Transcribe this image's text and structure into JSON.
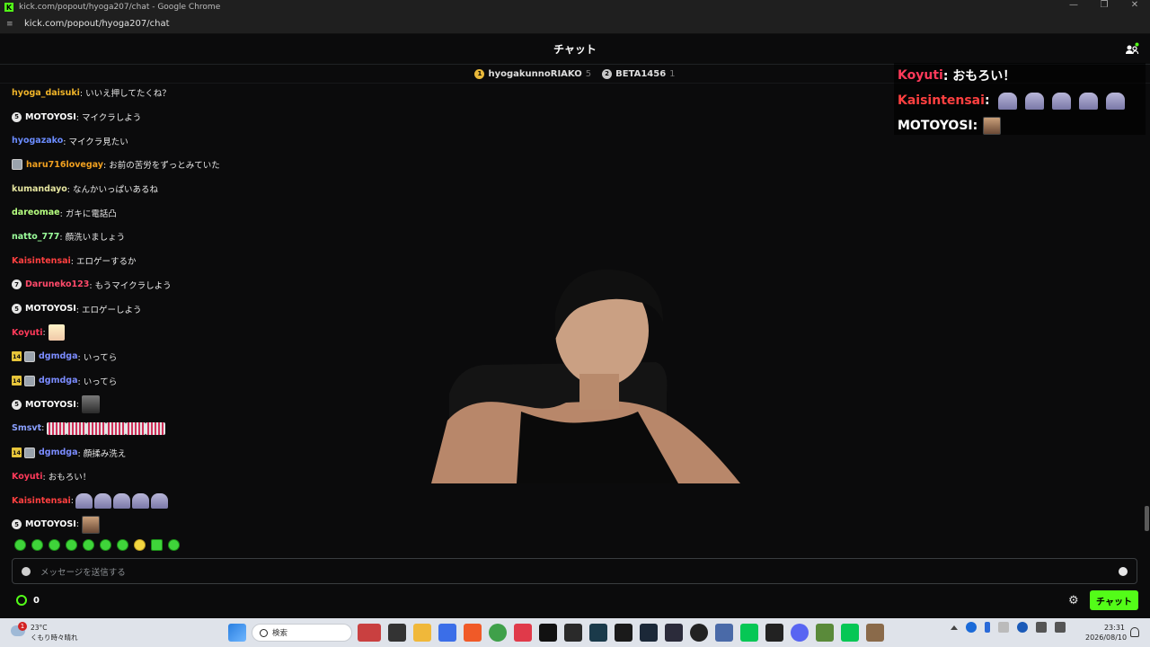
{
  "window": {
    "title": "kick.com/popout/hyoga207/chat - Google Chrome",
    "url": "kick.com/popout/hyoga207/chat"
  },
  "header": {
    "title": "チャット"
  },
  "gifters": [
    {
      "name": "hyogakunnoRIAKO",
      "count": "5",
      "color": "#e8b83a"
    },
    {
      "name": "BETA1456",
      "count": "1",
      "color": "#c8c8c8"
    }
  ],
  "colors": {
    "accent": "#53fc18"
  },
  "messages": [
    {
      "user": "hyoga_daisuki",
      "color": "#f0b429",
      "text": ": いいえ押してたくね？"
    },
    {
      "user": "MOTOYOSI",
      "color": "#ffffff",
      "badge": "5",
      "text": ": マイクラしよう"
    },
    {
      "user": "hyogazako",
      "color": "#6b8cff",
      "text": ": マイクラ見たい"
    },
    {
      "user": "haru716lovegay",
      "color": "#f0a020",
      "text": ": お前の苦労をずっとみていた"
    },
    {
      "user": "kumandayo",
      "color": "#e6e6a0",
      "text": ": なんかいっぱいあるね"
    },
    {
      "user": "dareomae",
      "color": "#b6ff80",
      "text": ": ガキに電話凸"
    },
    {
      "user": "natto_777",
      "color": "#9cff9c",
      "text": ": 顔洗いましょう"
    },
    {
      "user": "Kaisintensai",
      "color": "#ff4040",
      "text": ": エロゲーするか"
    },
    {
      "user": "Daruneko123",
      "color": "#ff4a6a",
      "badge": "7",
      "text": ": もうマイクラしよう"
    },
    {
      "user": "MOTOYOSI",
      "color": "#ffffff",
      "badge": "5",
      "text": ": エロゲーしよう"
    },
    {
      "user": "Koyuti",
      "color": "#ff3a5a",
      "text": ":"
    },
    {
      "user": "dgmdga",
      "color": "#7b8cff",
      "sub": "14",
      "text": ": いってら"
    },
    {
      "user": "dgmdga",
      "color": "#7b8cff",
      "sub": "14",
      "text": ": いってら"
    },
    {
      "user": "MOTOYOSI",
      "color": "#ffffff",
      "badge": "5",
      "text": ":"
    },
    {
      "user": "Smsvt",
      "color": "#8aa0ff",
      "text": ":"
    },
    {
      "user": "dgmdga",
      "color": "#7b8cff",
      "sub": "14",
      "text": ": 顔揉み洗え"
    },
    {
      "user": "Koyuti",
      "color": "#ff3a5a",
      "text": ": おもろい！"
    },
    {
      "user": "Kaisintensai",
      "color": "#ff4040",
      "text": ":"
    },
    {
      "user": "MOTOYOSI",
      "color": "#ffffff",
      "badge": "5",
      "text": ":"
    }
  ],
  "overlay": [
    {
      "user": "Koyuti",
      "color": "#ff3a5a",
      "text": " : おもろい！"
    },
    {
      "user": "Kaisintensai",
      "color": "#ff4040",
      "text": " :"
    },
    {
      "user": "MOTOYOSI",
      "color": "#ffffff",
      "text": " :"
    }
  ],
  "input": {
    "placeholder": "メッセージを送信する"
  },
  "footer": {
    "points": "0",
    "chat_button": "チャット"
  },
  "taskbar": {
    "temp": "23°C",
    "weather": "くもり時々晴れ",
    "weather_notif": "1",
    "search": "検索",
    "time": "23:31",
    "date": "2026/08/10"
  }
}
